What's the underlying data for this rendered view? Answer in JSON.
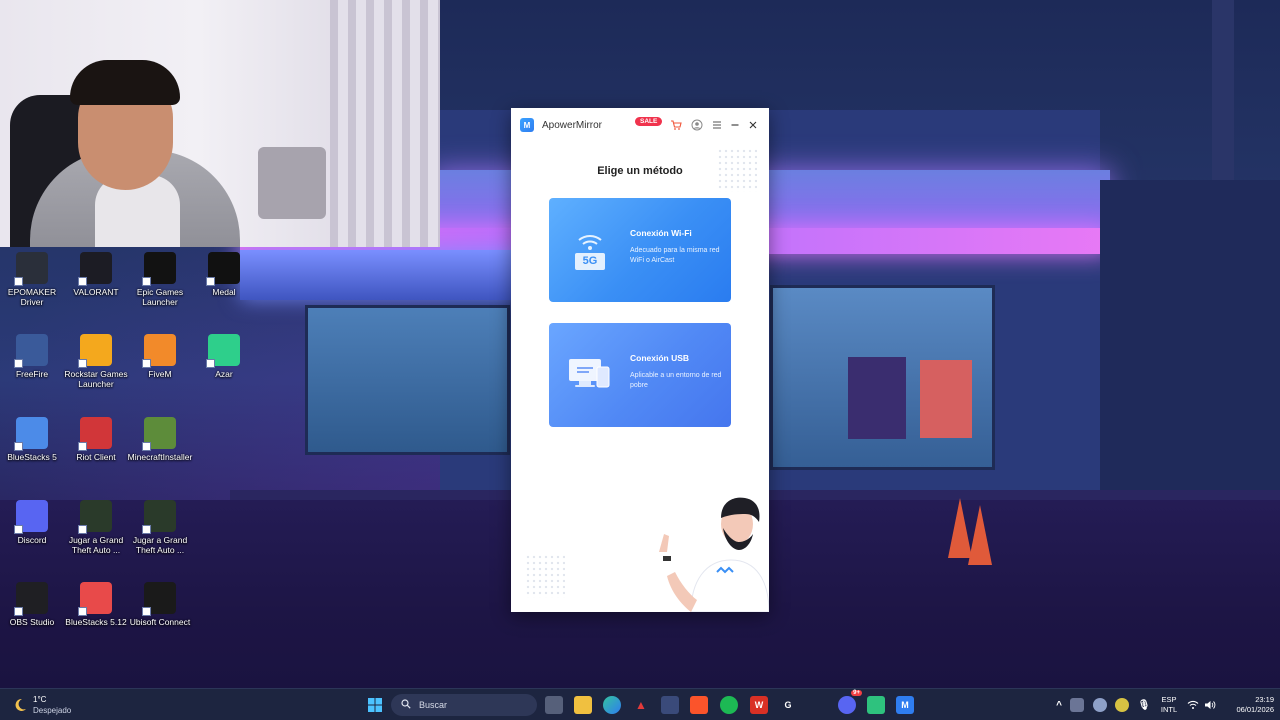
{
  "desktop": {
    "icons": [
      {
        "label": "EPOMAKER Driver",
        "icon": "epomaker-icon",
        "color": "#2a2f3a"
      },
      {
        "label": "VALORANT",
        "icon": "valorant-icon",
        "color": "#1c1c24"
      },
      {
        "label": "Epic Games Launcher",
        "icon": "epic-games-icon",
        "color": "#121212"
      },
      {
        "label": "Medal",
        "icon": "medal-icon",
        "color": "#111111"
      },
      {
        "label": "FreeFire",
        "icon": "freefire-icon",
        "color": "#3a5a9a"
      },
      {
        "label": "Rockstar Games Launcher",
        "icon": "rockstar-icon",
        "color": "#f4a81d"
      },
      {
        "label": "FiveM",
        "icon": "fivem-icon",
        "color": "#f28a2a"
      },
      {
        "label": "Azar",
        "icon": "azar-icon",
        "color": "#2ecf8b"
      },
      {
        "label": "BlueStacks 5",
        "icon": "bluestacks-icon",
        "color": "#4c8be8"
      },
      {
        "label": "Riot Client",
        "icon": "riot-client-icon",
        "color": "#d13639"
      },
      {
        "label": "MinecraftInstaller",
        "icon": "minecraft-icon",
        "color": "#5d8c3a"
      },
      {
        "label": "Discord",
        "icon": "discord-icon",
        "color": "#5865f2"
      },
      {
        "label": "Jugar a Grand Theft Auto ...",
        "icon": "gta-v-icon",
        "color": "#2a3a2a"
      },
      {
        "label": "Jugar a Grand Theft Auto ...",
        "icon": "gta-v-icon",
        "color": "#2a3a2a"
      },
      {
        "label": "OBS Studio",
        "icon": "obs-icon",
        "color": "#1f1f23"
      },
      {
        "label": "BlueStacks 5.12",
        "icon": "bluestacks-icon",
        "color": "#e84a4a"
      },
      {
        "label": "Ubisoft Connect",
        "icon": "ubisoft-icon",
        "color": "#1a1a1a"
      }
    ]
  },
  "app": {
    "name": "ApowerMirror",
    "sale_badge": "SALE",
    "heading": "Elige un método",
    "wifi_card": {
      "title": "Conexión Wi-Fi",
      "description": "Adecuado para la misma red WiFi o AirCast",
      "art_label": "5G"
    },
    "usb_card": {
      "title": "Conexión USB",
      "description": "Aplicable a un entorno de red pobre"
    },
    "accent_color": "#2f7df0"
  },
  "taskbar": {
    "weather": {
      "temperature": "1°C",
      "condition": "Despejado"
    },
    "search_placeholder": "Buscar",
    "language": "ESP",
    "layout": "INTL",
    "time": "23:19",
    "date": "06/01/2026",
    "notification_badge": "9+"
  }
}
